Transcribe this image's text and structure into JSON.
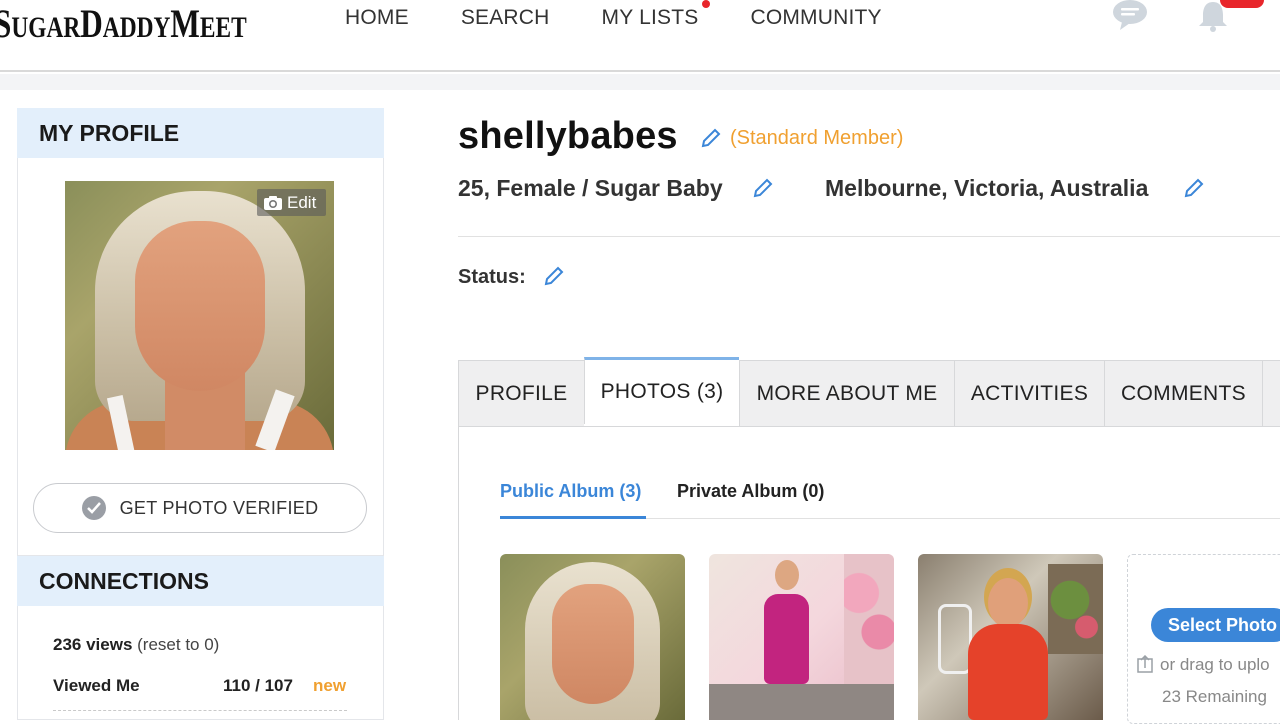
{
  "header": {
    "logo_part1": "S",
    "logo_part2": "UGAR",
    "logo_part3": "D",
    "logo_part4": "ADDY",
    "logo_part5": "M",
    "logo_part6": "EET",
    "nav": [
      {
        "label": "HOME"
      },
      {
        "label": "SEARCH"
      },
      {
        "label": "MY LISTS"
      },
      {
        "label": "COMMUNITY"
      }
    ]
  },
  "sidebar": {
    "profile_heading": "MY PROFILE",
    "edit_label": "Edit",
    "verify_label": "GET PHOTO VERIFIED",
    "connections_heading": "CONNECTIONS",
    "views_count": "236 views",
    "views_reset": "(reset to 0)",
    "viewed_me_label": "Viewed Me",
    "viewed_me_count": "110 / 107",
    "viewed_me_new": "new"
  },
  "profile": {
    "username": "shellybabes",
    "membership": "(Standard Member)",
    "details": "25, Female / Sugar Baby",
    "location": "Melbourne, Victoria, Australia",
    "status_label": "Status:"
  },
  "tabs": [
    {
      "label": "PROFILE"
    },
    {
      "label": "PHOTOS (3)"
    },
    {
      "label": "MORE ABOUT ME"
    },
    {
      "label": "ACTIVITIES"
    },
    {
      "label": "COMMENTS"
    }
  ],
  "albums": {
    "public": "Public Album (3)",
    "private": "Private Album (0)"
  },
  "upload": {
    "select_label": "Select Photo",
    "drag_text": "or drag to uplo",
    "remaining": "23 Remaining"
  },
  "colors": {
    "accent_blue": "#3b86d8",
    "member_orange": "#f0a030",
    "notification_red": "#e8262b",
    "sidebar_header_bg": "#e3effb"
  }
}
